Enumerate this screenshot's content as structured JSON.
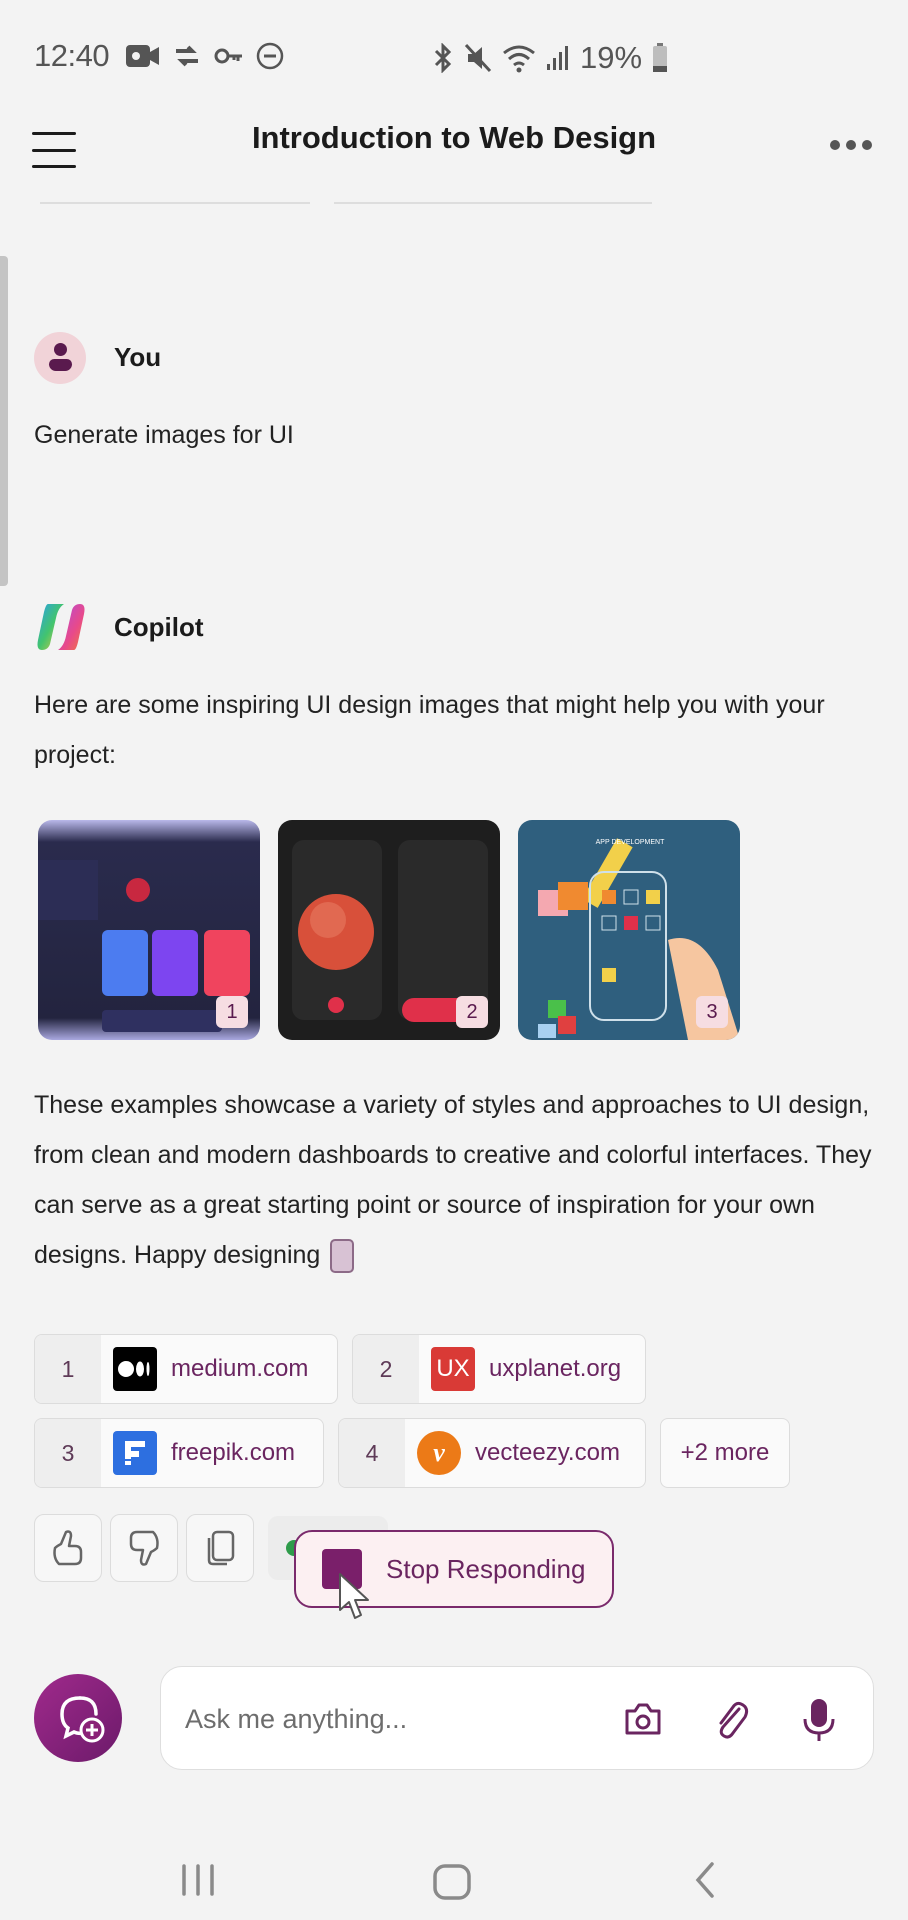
{
  "status_bar": {
    "time": "12:40",
    "left_icons": [
      "video-camera-icon",
      "sync-icon",
      "key-icon",
      "do-not-disturb-icon"
    ],
    "right_icons": [
      "bluetooth-icon",
      "mute-icon",
      "wifi-icon",
      "signal-icon"
    ],
    "battery": "19%"
  },
  "header": {
    "title": "Introduction to Web Design",
    "menu_icon": "hamburger-icon",
    "more_icon": "more-dots-icon"
  },
  "conversation": {
    "user": {
      "name": "You",
      "message": "Generate images for UI"
    },
    "assistant": {
      "name": "Copilot",
      "intro": "Here are some inspiring UI design images that might help you with your project:",
      "images": [
        {
          "badge": "1",
          "description": "Dark dashboard UI design"
        },
        {
          "badge": "2",
          "description": "Dark music player app UI"
        },
        {
          "badge": "3",
          "description": "App development concept illustration"
        }
      ],
      "image3_caption": "APP DEVELOPMENT",
      "body": "These examples showcase a variety of styles and approaches to UI design, from clean and modern dashboards to creative and colorful interfaces. They can serve as a great starting point or source of inspiration for your own designs. Happy designing",
      "citations": [
        {
          "num": "1",
          "label": "medium.com",
          "logo": "medium-logo",
          "logo_color": "#000000"
        },
        {
          "num": "2",
          "label": "uxplanet.org",
          "logo": "uxplanet-logo",
          "logo_text": "UX",
          "logo_color": "#d93a36"
        },
        {
          "num": "3",
          "label": "freepik.com",
          "logo": "freepik-logo",
          "logo_color": "#2d6fe0"
        },
        {
          "num": "4",
          "label": "vecteezy.com",
          "logo": "vecteezy-logo",
          "logo_color": "#ec7a17"
        }
      ],
      "more_citations": "+2 more"
    }
  },
  "actions": {
    "thumbs_up": "thumbs-up-icon",
    "thumbs_down": "thumbs-down-icon",
    "copy": "copy-icon",
    "stop_label": "Stop Responding"
  },
  "input": {
    "placeholder": "Ask me anything...",
    "value": ""
  },
  "colors": {
    "accent": "#7a1f6a",
    "background": "#f3f3f3"
  }
}
